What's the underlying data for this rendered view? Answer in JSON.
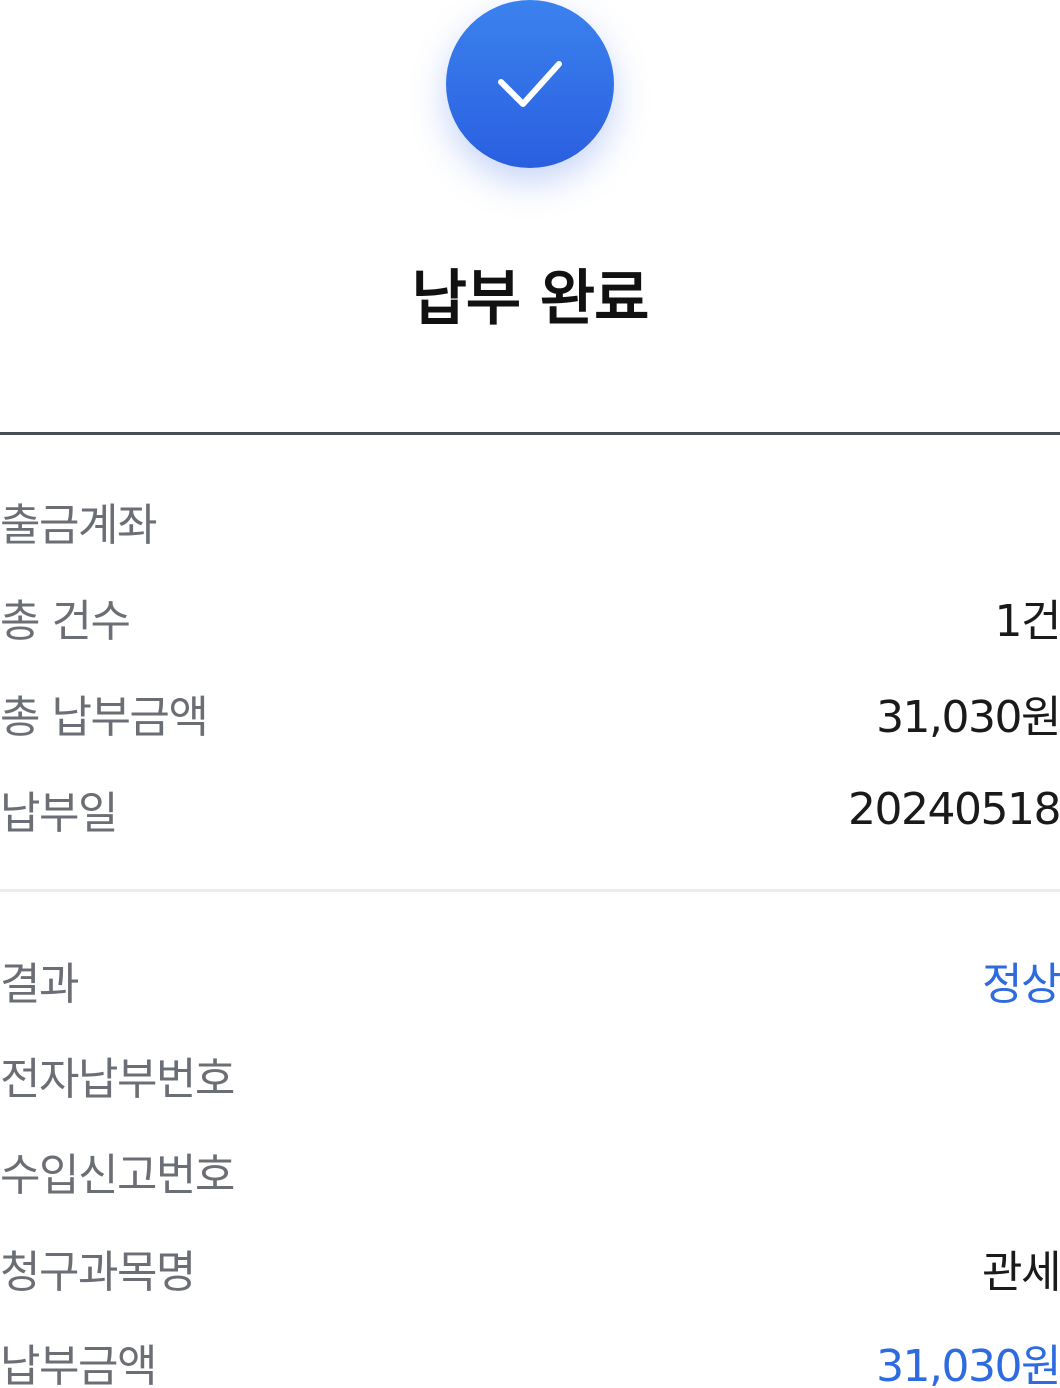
{
  "header": {
    "title": "납부 완료",
    "icon": "check-icon",
    "accent_color": "#2f6be0"
  },
  "summary": [
    {
      "label": "출금계좌",
      "value": ""
    },
    {
      "label": "총 건수",
      "value": "1건"
    },
    {
      "label": "총 납부금액",
      "value": "31,030원"
    },
    {
      "label": "납부일",
      "value": "20240518"
    }
  ],
  "details": [
    {
      "label": "결과",
      "value": "정상",
      "highlight": true
    },
    {
      "label": "전자납부번호",
      "value": ""
    },
    {
      "label": "수입신고번호",
      "value": ""
    },
    {
      "label": "청구과목명",
      "value": "관세"
    },
    {
      "label": "납부금액",
      "value": "31,030원",
      "highlight": true
    }
  ]
}
